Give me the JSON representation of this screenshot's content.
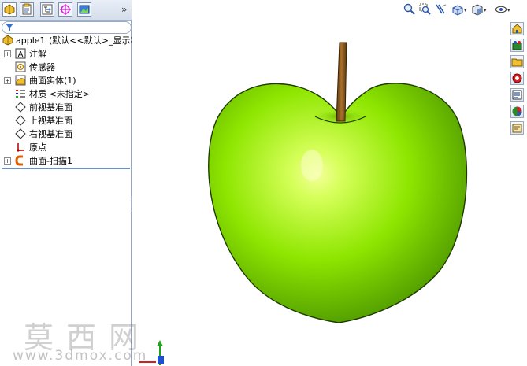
{
  "feature_tree": {
    "part_name": "apple1",
    "part_config": "(默认<<默认>_显示状",
    "items": [
      {
        "label": "注解",
        "icon": "annotation-icon",
        "expandable": true
      },
      {
        "label": "传感器",
        "icon": "sensor-icon",
        "expandable": false
      },
      {
        "label": "曲面实体(1)",
        "icon": "surface-bodies-icon",
        "expandable": true
      },
      {
        "label": "材质 <未指定>",
        "icon": "material-icon",
        "expandable": false
      },
      {
        "label": "前视基准面",
        "icon": "plane-icon",
        "expandable": false
      },
      {
        "label": "上视基准面",
        "icon": "plane-icon",
        "expandable": false
      },
      {
        "label": "右视基准面",
        "icon": "plane-icon",
        "expandable": false
      },
      {
        "label": "原点",
        "icon": "origin-icon",
        "expandable": false
      },
      {
        "label": "曲面-扫描1",
        "icon": "sweep-surface-icon",
        "expandable": true
      }
    ]
  },
  "panel_tabs": [
    "feature-manager-tab",
    "property-manager-tab",
    "configuration-manager-tab",
    "dimxpert-manager-tab",
    "display-manager-tab"
  ],
  "more_tabs_glyph": "»",
  "tree_expand_glyph": "+",
  "handle_glyph": "⋮",
  "view_toolbar": [
    "zoom-to-fit-icon",
    "zoom-to-area-icon",
    "section-view-icon",
    "view-orientation-icon",
    "display-style-icon",
    "hide-show-icon"
  ],
  "task_pane": [
    "solidworks-resources-icon",
    "design-library-icon",
    "file-explorer-icon",
    "search-icon",
    "view-palette-icon",
    "appearances-icon",
    "custom-properties-icon"
  ],
  "watermark": {
    "cn": "莫西网",
    "url": "www.3dmox.com"
  },
  "colors": {
    "apple_light": "#d6ff5a",
    "apple_mid": "#8ee600",
    "apple_dark": "#4f9a00",
    "stem": "#8b5a1e"
  }
}
